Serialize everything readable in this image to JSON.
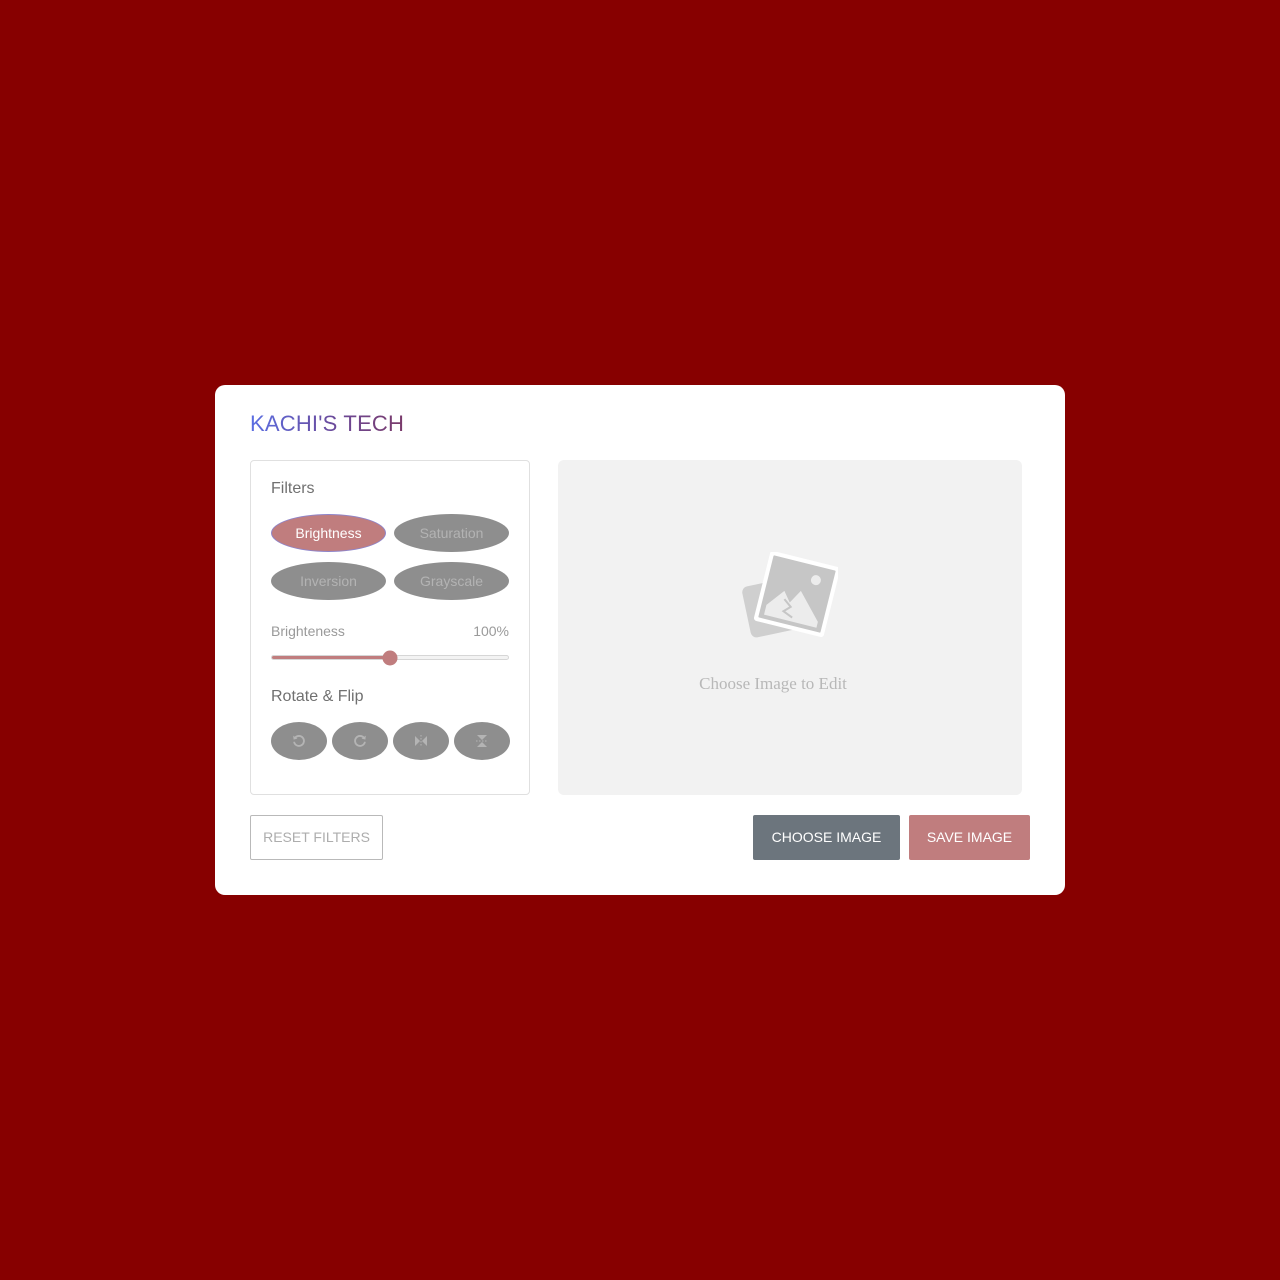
{
  "app": {
    "title": "KACHI'S TECH"
  },
  "filters": {
    "heading": "Filters",
    "options": [
      {
        "label": "Brightness",
        "active": true
      },
      {
        "label": "Saturation",
        "active": false
      },
      {
        "label": "Inversion",
        "active": false
      },
      {
        "label": "Grayscale",
        "active": false
      }
    ]
  },
  "slider": {
    "name": "Brighteness",
    "value_text": "100%",
    "fraction": 0.5
  },
  "rotate": {
    "heading": "Rotate & Flip",
    "buttons": [
      {
        "icon": "rotate-left-icon"
      },
      {
        "icon": "rotate-right-icon"
      },
      {
        "icon": "flip-horizontal-icon"
      },
      {
        "icon": "flip-vertical-icon"
      }
    ]
  },
  "preview": {
    "placeholder_text": "Choose Image to Edit",
    "icon": "image-placeholder-icon"
  },
  "actions": {
    "reset_label": "RESET FILTERS",
    "choose_label": "CHOOSE IMAGE",
    "save_label": "SAVE IMAGE"
  },
  "colors": {
    "background": "#870000",
    "accent": "#c07d7e",
    "secondary": "#6c757d",
    "inactive_button": "#8e8e8e"
  }
}
